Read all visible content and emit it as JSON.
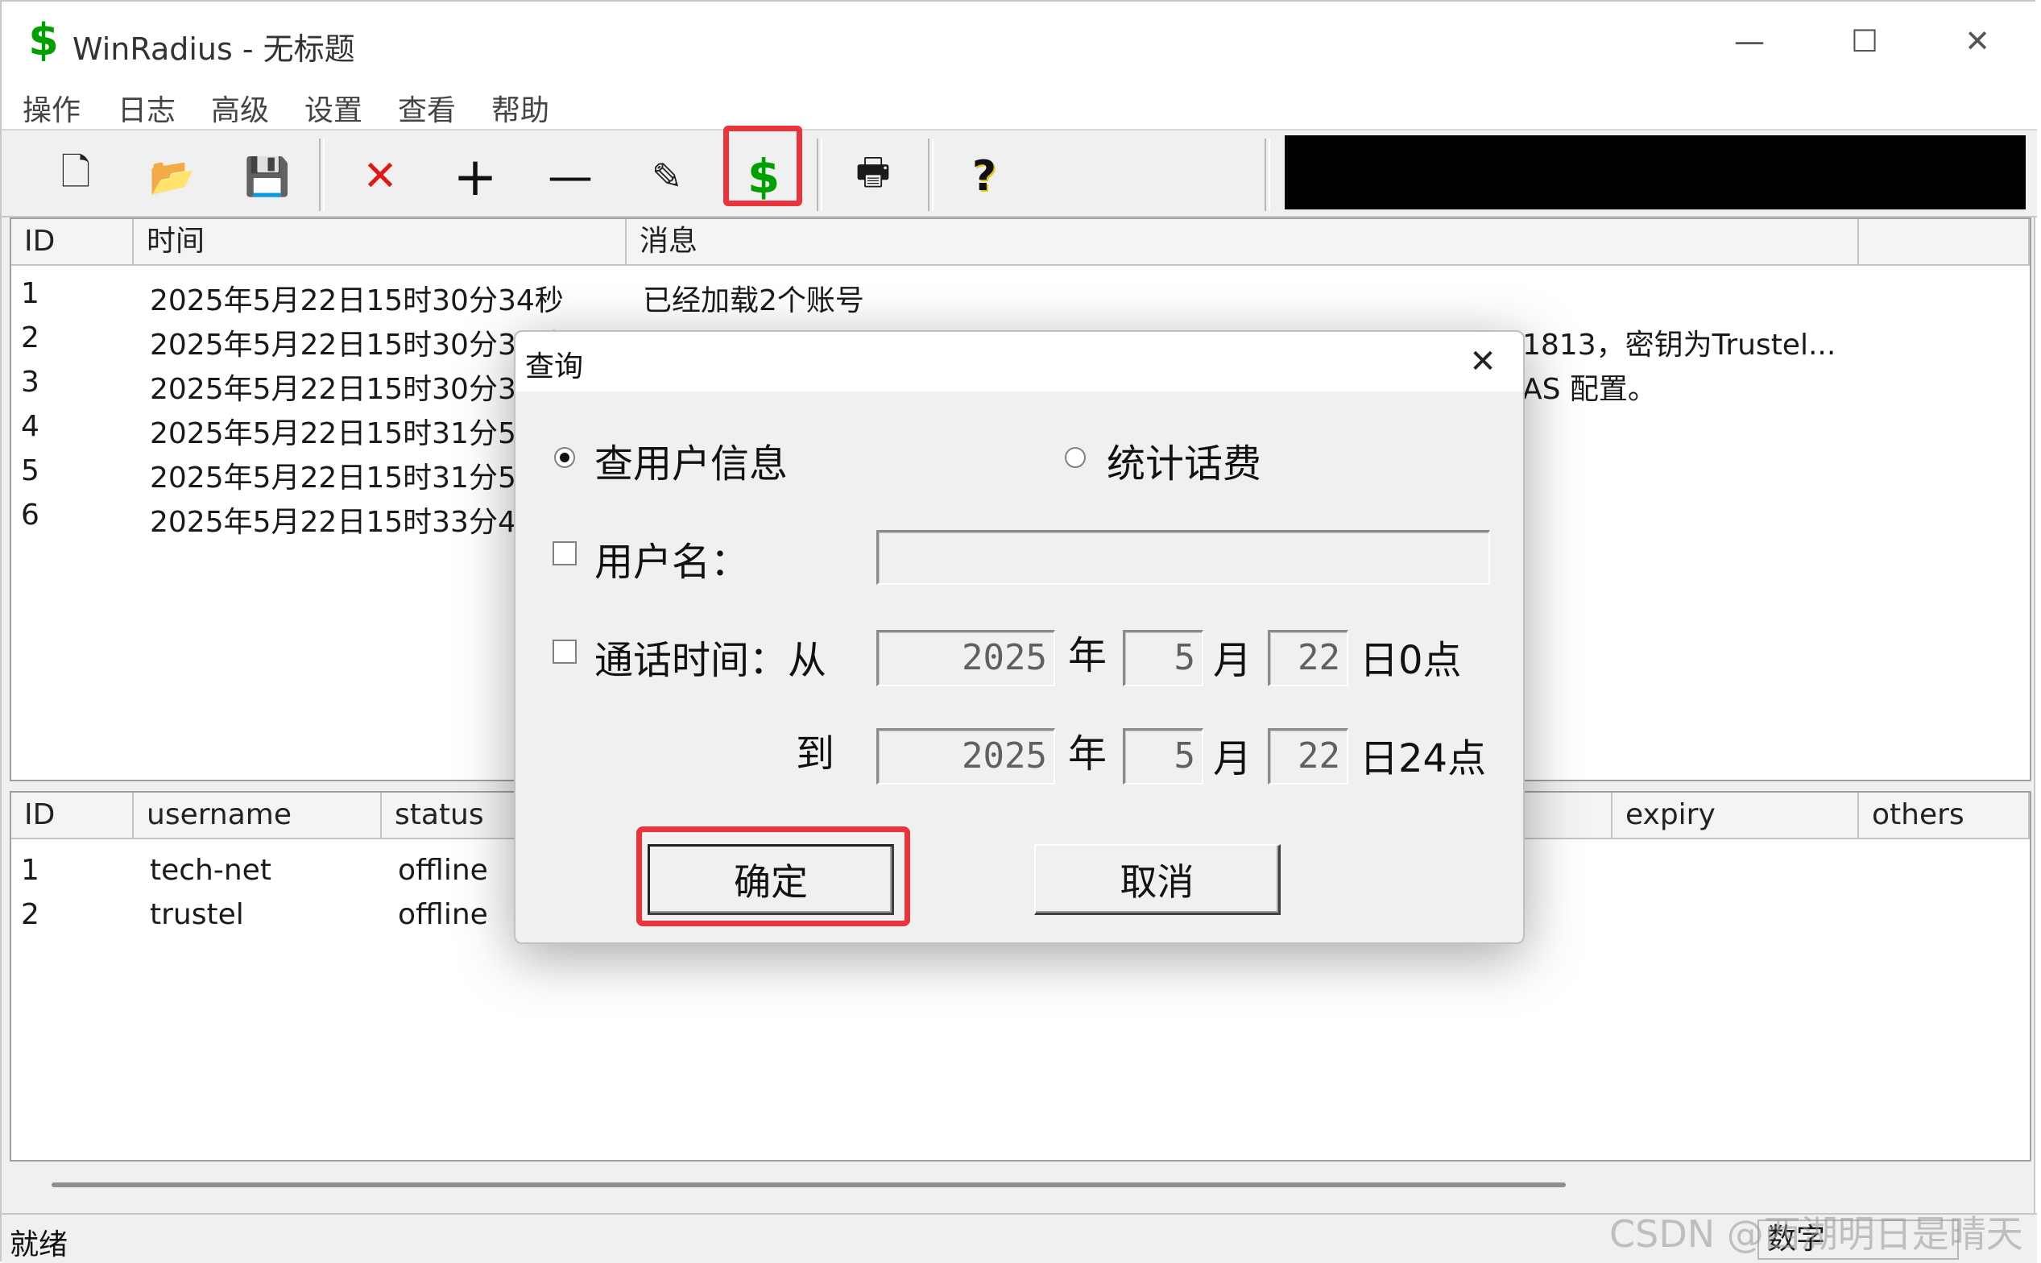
{
  "window": {
    "title": "WinRadius - 无标题",
    "controls": {
      "minimize": "—",
      "maximize": "☐",
      "close": "✕"
    }
  },
  "menu": [
    "操作",
    "日志",
    "高级",
    "设置",
    "查看",
    "帮助"
  ],
  "toolbar": {
    "icons": [
      "new-file-icon",
      "open-folder-icon",
      "save-disk-icon",
      "delete-x-icon",
      "add-plus-icon",
      "remove-minus-icon",
      "edit-note-icon",
      "dollar-query-icon",
      "printer-icon",
      "help-question-icon"
    ],
    "glyphs": {
      "new": "🗋",
      "open": "📂",
      "save": "💾",
      "delete": "✕",
      "add": "+",
      "remove": "—",
      "edit": "✎",
      "dollar": "$",
      "print": "🖶",
      "help": "?"
    },
    "highlight_color": "#e8343a"
  },
  "log_table": {
    "headers": [
      "ID",
      "时间",
      "消息"
    ],
    "rows": [
      {
        "id": "1",
        "time": "2025年5月22日15时30分34秒",
        "message": "已经加载2个账号"
      },
      {
        "id": "2",
        "time": "2025年5月22日15时30分34秒",
        "message": "1813，密钥为Trustel..."
      },
      {
        "id": "3",
        "time": "2025年5月22日15时30分34",
        "message": "AS 配置。"
      },
      {
        "id": "4",
        "time": "2025年5月22日15时31分59",
        "message": ""
      },
      {
        "id": "5",
        "time": "2025年5月22日15时31分59",
        "message": ""
      },
      {
        "id": "6",
        "time": "2025年5月22日15时33分45",
        "message": ""
      }
    ]
  },
  "user_table": {
    "headers": [
      "ID",
      "username",
      "status",
      "expiry",
      "others"
    ],
    "rows": [
      {
        "id": "1",
        "username": "tech-net",
        "status": "offline"
      },
      {
        "id": "2",
        "username": "trustel",
        "status": "offline"
      }
    ]
  },
  "statusbar": {
    "text": "就绪",
    "numlock": "数字",
    "watermark": "CSDN @西湖明日是晴天"
  },
  "dialog": {
    "title": "查询",
    "close": "✕",
    "radio_user_info": "查用户信息",
    "radio_stats": "统计话费",
    "username_label": "用户名：",
    "username_value": "",
    "call_time_label": "通话时间：从",
    "from": {
      "year": "2025",
      "month": "5",
      "day": "22",
      "hour_suffix": "日0点"
    },
    "to_label": "到",
    "to": {
      "year": "2025",
      "month": "5",
      "day": "22",
      "hour_suffix": "日24点"
    },
    "year_unit": "年",
    "month_unit": "月",
    "ok_label": "确定",
    "cancel_label": "取消"
  }
}
